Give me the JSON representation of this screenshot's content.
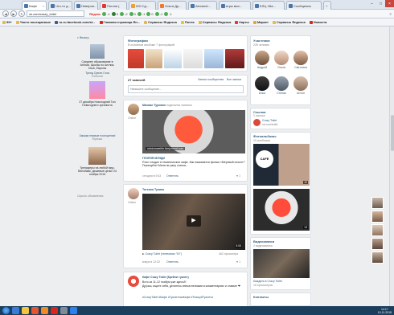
{
  "browser": {
    "tabs": [
      {
        "label": "Кафе",
        "active": true
      },
      {
        "label": "Что-то д..."
      },
      {
        "label": "Невероя..."
      },
      {
        "label": "Погоня ("
      },
      {
        "label": "000 Сд..."
      },
      {
        "label": "Ольга Др..."
      },
      {
        "label": "Alexandr..."
      },
      {
        "label": "игры вых..."
      },
      {
        "label": "БЛЦ «Ва..."
      },
      {
        "label": "Сообщения"
      }
    ],
    "url": "vk.com/crazy_toilet",
    "yandex_label": "Яндекс",
    "toolbar_counts": [
      "-1",
      "0",
      "-2",
      "0",
      "-1",
      "0",
      "-1",
      "-1"
    ]
  },
  "bookmarks": [
    "99+",
    "Часто посещаемые",
    "ru-ru.facebook.com/st...",
    "Главная страница Ян...",
    "Сервисы Яндекса",
    "Почта",
    "Сервисы Яндекса",
    "Карты",
    "Маркет",
    "Сервисы Яндекса",
    "Новости"
  ],
  "left_col": {
    "more_label": "Фильтр",
    "items": [
      {
        "title": "",
        "text": "Среднее образование в Англии. Школы по Англии, США, Европы"
      },
      {
        "title": "Тренд Орели Гола",
        "text": "Событие"
      },
      {
        "title": "",
        "text": "27 декабря Новогодний Тал Новогоднего органиста"
      },
      {
        "title": "Закажи первые посещения!",
        "text": "Музыка"
      },
      {
        "title": "",
        "text": "Тренажеры на любой вкус. Велобайк, дешевые цены! 24 ноября 2015"
      }
    ],
    "hide_label": "Скрыть объявления"
  },
  "photos": {
    "title": "Фотографии",
    "subtitle": "В основном альбоме 7 фотографий",
    "all": "Все"
  },
  "wall": {
    "count_label": "27 записей",
    "tabs": [
      "Записи сообщества",
      "Все записи"
    ],
    "composer_placeholder": "Напишите сообщение...",
    "post1": {
      "author": "Михаил Туровин",
      "action": "поделился записью",
      "sub_author": "Online",
      "source": "Crazy Toilet",
      "quote_title": "ГЛОРИЯ МУНДИ",
      "quote_text": "Я вот сходил в тематическое кафе. Как называется фильм «Мертвый сезон»? Пожалуйте! Меня не рану стенка...",
      "link_url": "ndoturowelhh.livejournal.com",
      "date": "сегодня в 9:43",
      "reply": "Ответить",
      "likes": "1"
    },
    "post2": {
      "author": "Татьяна Туника",
      "sub_author": "Online",
      "video_title": "Crazy Toilet (телеканал \"Ю\")",
      "views": "462 просмотра",
      "video_time": "5:05",
      "date": "вчера в 12:32",
      "reply": "Ответить",
      "likes": "1"
    },
    "post3": {
      "author": "Кафе Crazy Toilet (Крейзи туалет)",
      "text1": "Вото за 11-12 ноября уже здесь!!!",
      "text2": "Друзья, ищите себя, делитесь впечатлениями в комментариях и ставьте ❤",
      "hashtags": "#CrazyToilet #Кафе #ТуалетнаяКафе #ТеашуйТуалета"
    }
  },
  "members": {
    "title": "Участники",
    "count": "226 человек",
    "people": [
      {
        "name": "Андрей"
      },
      {
        "name": "Ольга"
      },
      {
        "name": "Светлана"
      },
      {
        "name": "Илья"
      },
      {
        "name": "Степан"
      },
      {
        "name": "Антон"
      }
    ]
  },
  "links": {
    "title": "Ссылки",
    "count": "1 ссылка",
    "item": "Crazy Toilet",
    "sub": "vk.com/toilet"
  },
  "albums": {
    "title": "Фотоальбомы",
    "count": "10 альбомов",
    "a1_label": "CAFE",
    "a1_count": "12",
    "a2_count": "13"
  },
  "videos": {
    "title": "Видеозаписи",
    "count": "2 видеозаписи",
    "item": "Каждать в Crazy Toilet",
    "views": "15 просмотров"
  },
  "contacts": {
    "title": "Контакты"
  },
  "taskbar": {
    "time": "14:17",
    "date": "10.11.2015"
  }
}
